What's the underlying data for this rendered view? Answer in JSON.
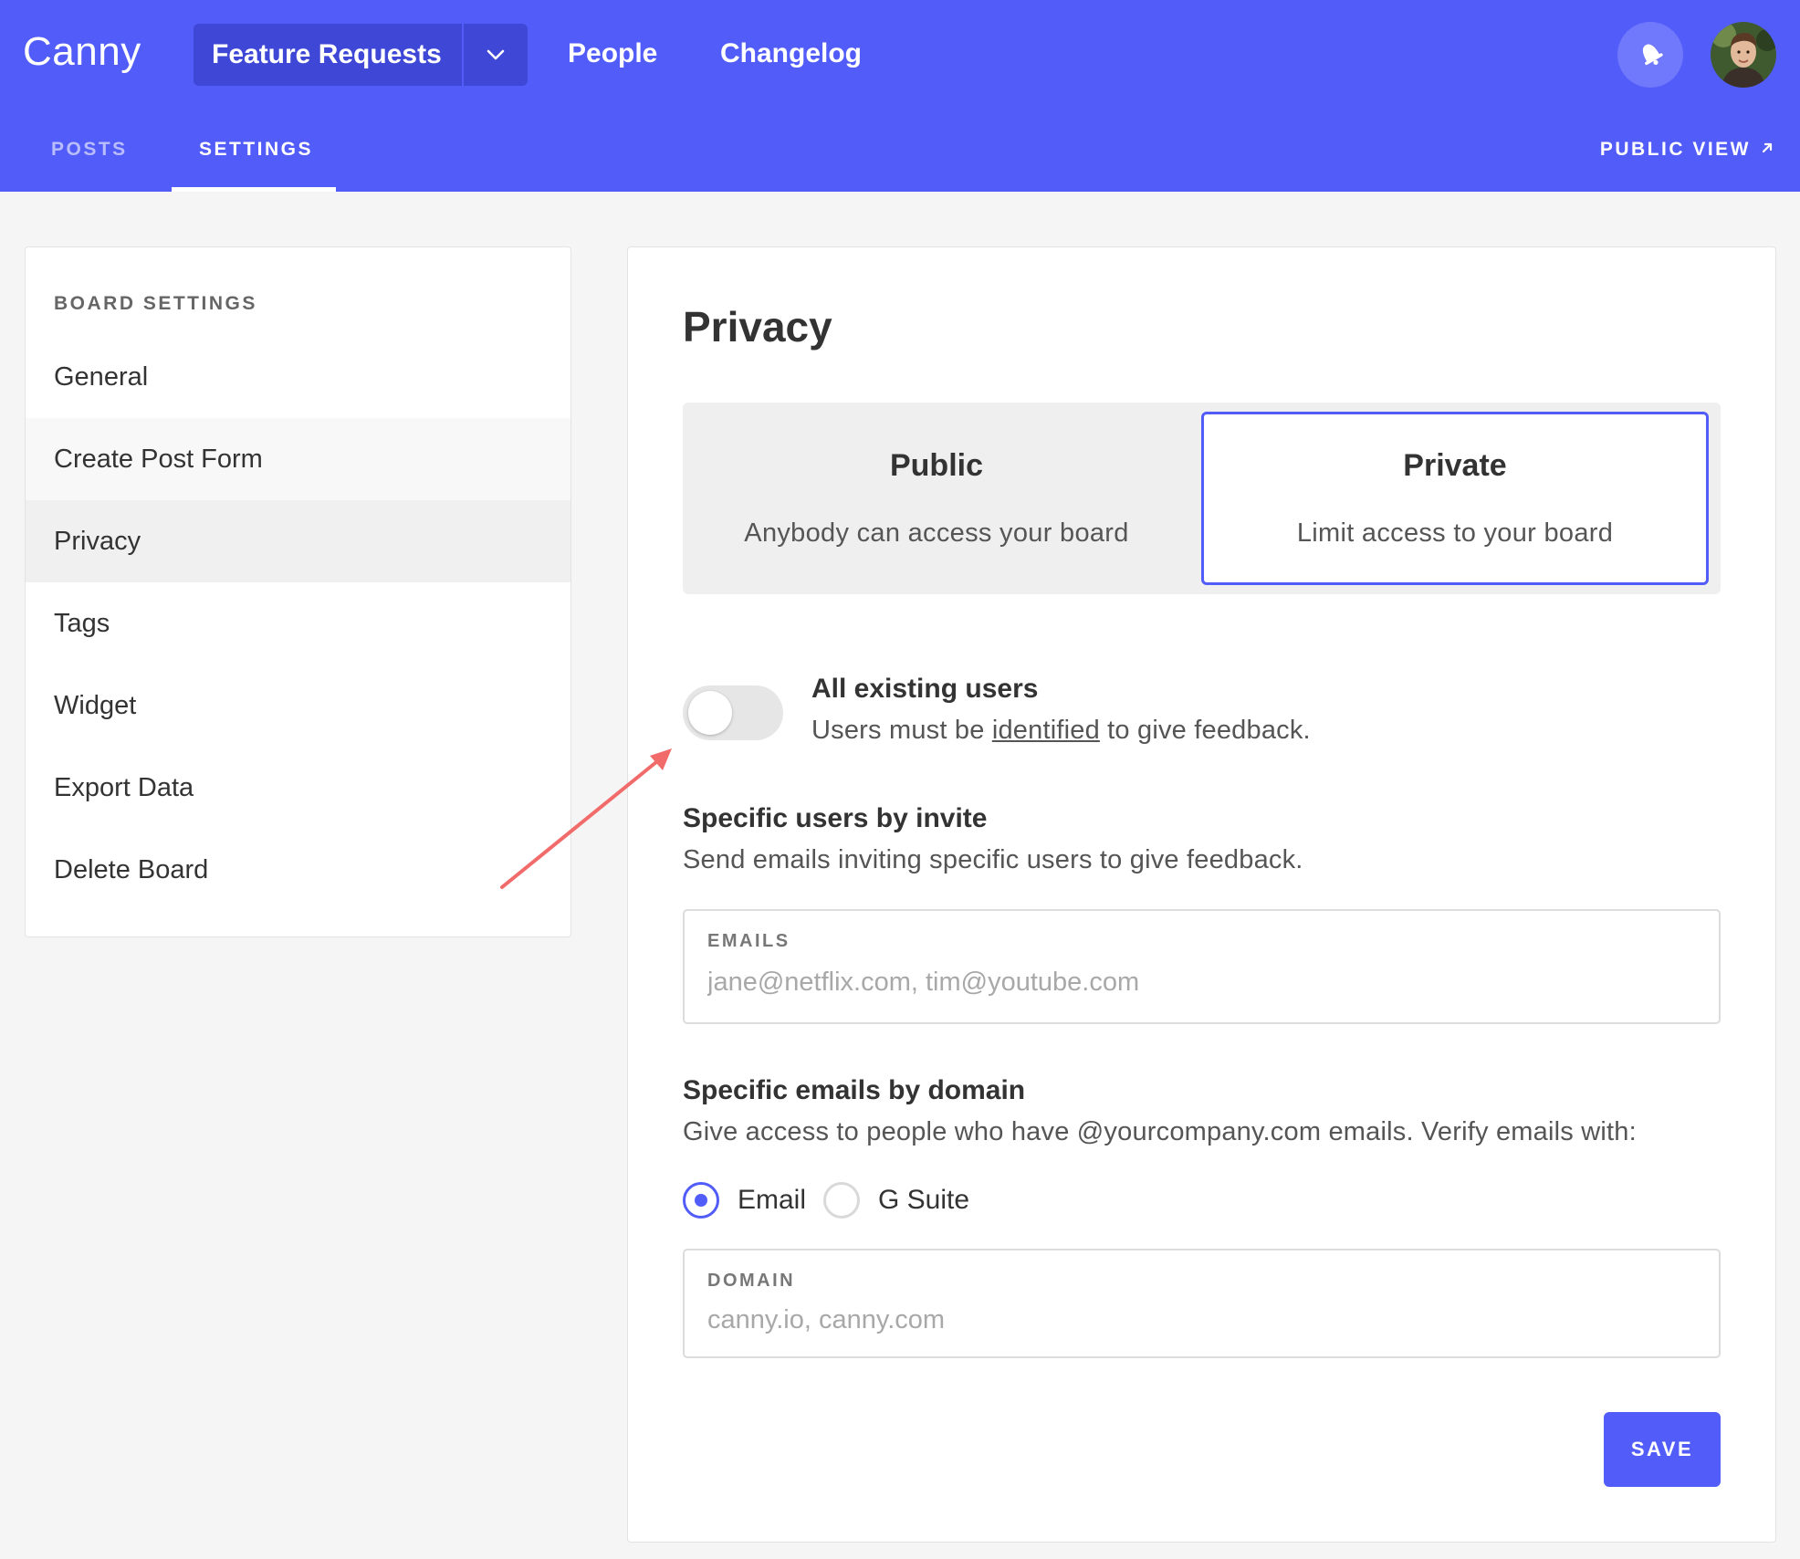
{
  "header": {
    "logo": "Canny",
    "board_selector": "Feature Requests",
    "nav": [
      "People",
      "Changelog"
    ],
    "tabs": [
      {
        "label": "POSTS",
        "active": false
      },
      {
        "label": "SETTINGS",
        "active": true
      }
    ],
    "public_view": "PUBLIC VIEW",
    "icons": [
      "chevron-down-icon",
      "bell-icon",
      "arrow-up-right-icon"
    ]
  },
  "sidebar": {
    "heading": "BOARD SETTINGS",
    "items": [
      {
        "label": "General"
      },
      {
        "label": "Create Post Form"
      },
      {
        "label": "Privacy",
        "active": true
      },
      {
        "label": "Tags"
      },
      {
        "label": "Widget"
      },
      {
        "label": "Export Data"
      },
      {
        "label": "Delete Board"
      }
    ]
  },
  "main": {
    "title": "Privacy",
    "options": [
      {
        "title": "Public",
        "desc": "Anybody can access your board",
        "selected": false
      },
      {
        "title": "Private",
        "desc": "Limit access to your board",
        "selected": true
      }
    ],
    "existing_users": {
      "title": "All existing users",
      "desc_prefix": "Users must be ",
      "desc_link": "identified",
      "desc_suffix": " to give feedback.",
      "enabled": false
    },
    "invite": {
      "title": "Specific users by invite",
      "desc": "Send emails inviting specific users to give feedback.",
      "field_label": "EMAILS",
      "placeholder": "jane@netflix.com, tim@youtube.com",
      "value": ""
    },
    "domain": {
      "title": "Specific emails by domain",
      "desc": "Give access to people who have @yourcompany.com emails. Verify emails with:",
      "verify_options": [
        {
          "label": "Email",
          "checked": true
        },
        {
          "label": "G Suite",
          "checked": false
        }
      ],
      "field_label": "DOMAIN",
      "placeholder": "canny.io, canny.com",
      "value": ""
    },
    "save_label": "SAVE"
  },
  "colors": {
    "accent": "#525df9",
    "accent_dark": "#3e47d6",
    "annotation_arrow": "#f26b6b",
    "background": "#f5f5f5"
  }
}
